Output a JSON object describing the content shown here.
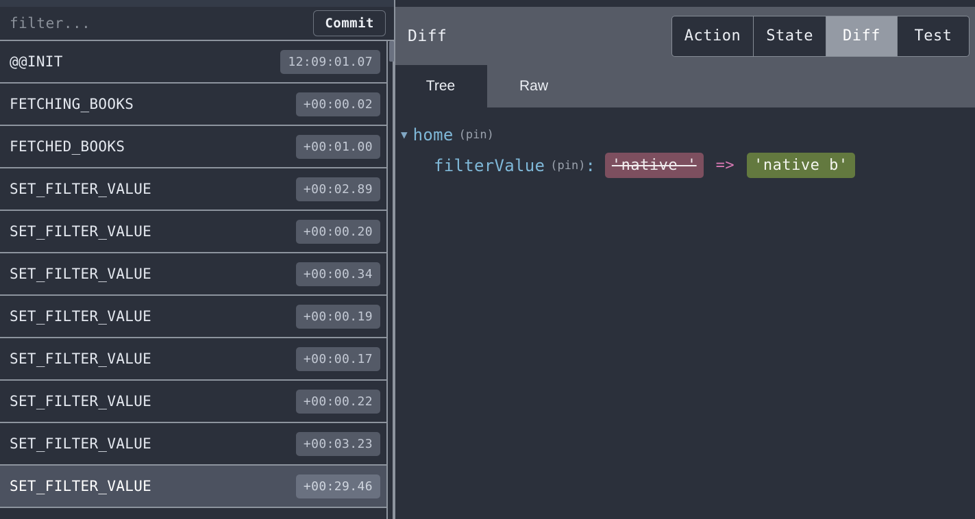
{
  "left_panel": {
    "filter": {
      "value": "",
      "placeholder": "filter..."
    },
    "commit_label": "Commit",
    "actions": [
      {
        "name": "@@INIT",
        "time": "12:09:01.07",
        "selected": false
      },
      {
        "name": "FETCHING_BOOKS",
        "time": "+00:00.02",
        "selected": false
      },
      {
        "name": "FETCHED_BOOKS",
        "time": "+00:01.00",
        "selected": false
      },
      {
        "name": "SET_FILTER_VALUE",
        "time": "+00:02.89",
        "selected": false
      },
      {
        "name": "SET_FILTER_VALUE",
        "time": "+00:00.20",
        "selected": false
      },
      {
        "name": "SET_FILTER_VALUE",
        "time": "+00:00.34",
        "selected": false
      },
      {
        "name": "SET_FILTER_VALUE",
        "time": "+00:00.19",
        "selected": false
      },
      {
        "name": "SET_FILTER_VALUE",
        "time": "+00:00.17",
        "selected": false
      },
      {
        "name": "SET_FILTER_VALUE",
        "time": "+00:00.22",
        "selected": false
      },
      {
        "name": "SET_FILTER_VALUE",
        "time": "+00:03.23",
        "selected": false
      },
      {
        "name": "SET_FILTER_VALUE",
        "time": "+00:29.46",
        "selected": true
      }
    ]
  },
  "right_panel": {
    "title": "Diff",
    "tabs": [
      {
        "label": "Action",
        "active": false
      },
      {
        "label": "State",
        "active": false
      },
      {
        "label": "Diff",
        "active": true
      },
      {
        "label": "Test",
        "active": false
      }
    ],
    "subtabs": [
      {
        "label": "Tree",
        "active": true
      },
      {
        "label": "Raw",
        "active": false
      }
    ],
    "diff": {
      "caret_icon": "▼",
      "root_key": "home",
      "root_pin": "(pin)",
      "entry_key": "filterValue",
      "entry_pin": "(pin)",
      "colon": ":",
      "old_value": "'native '",
      "arrow": "=>",
      "new_value": "'native b'"
    }
  },
  "colors": {
    "panel_bg": "#2b303b",
    "header_bg": "#565b66",
    "border": "#8d949e",
    "selected_row": "#4c5260",
    "badge": "#545a67",
    "key_blue": "#7fb8d8",
    "value_removed_bg": "#7d4f5f",
    "value_added_bg": "#63793f",
    "arrow_pink": "#d979b5",
    "tab_active_bg": "#949aa4"
  }
}
